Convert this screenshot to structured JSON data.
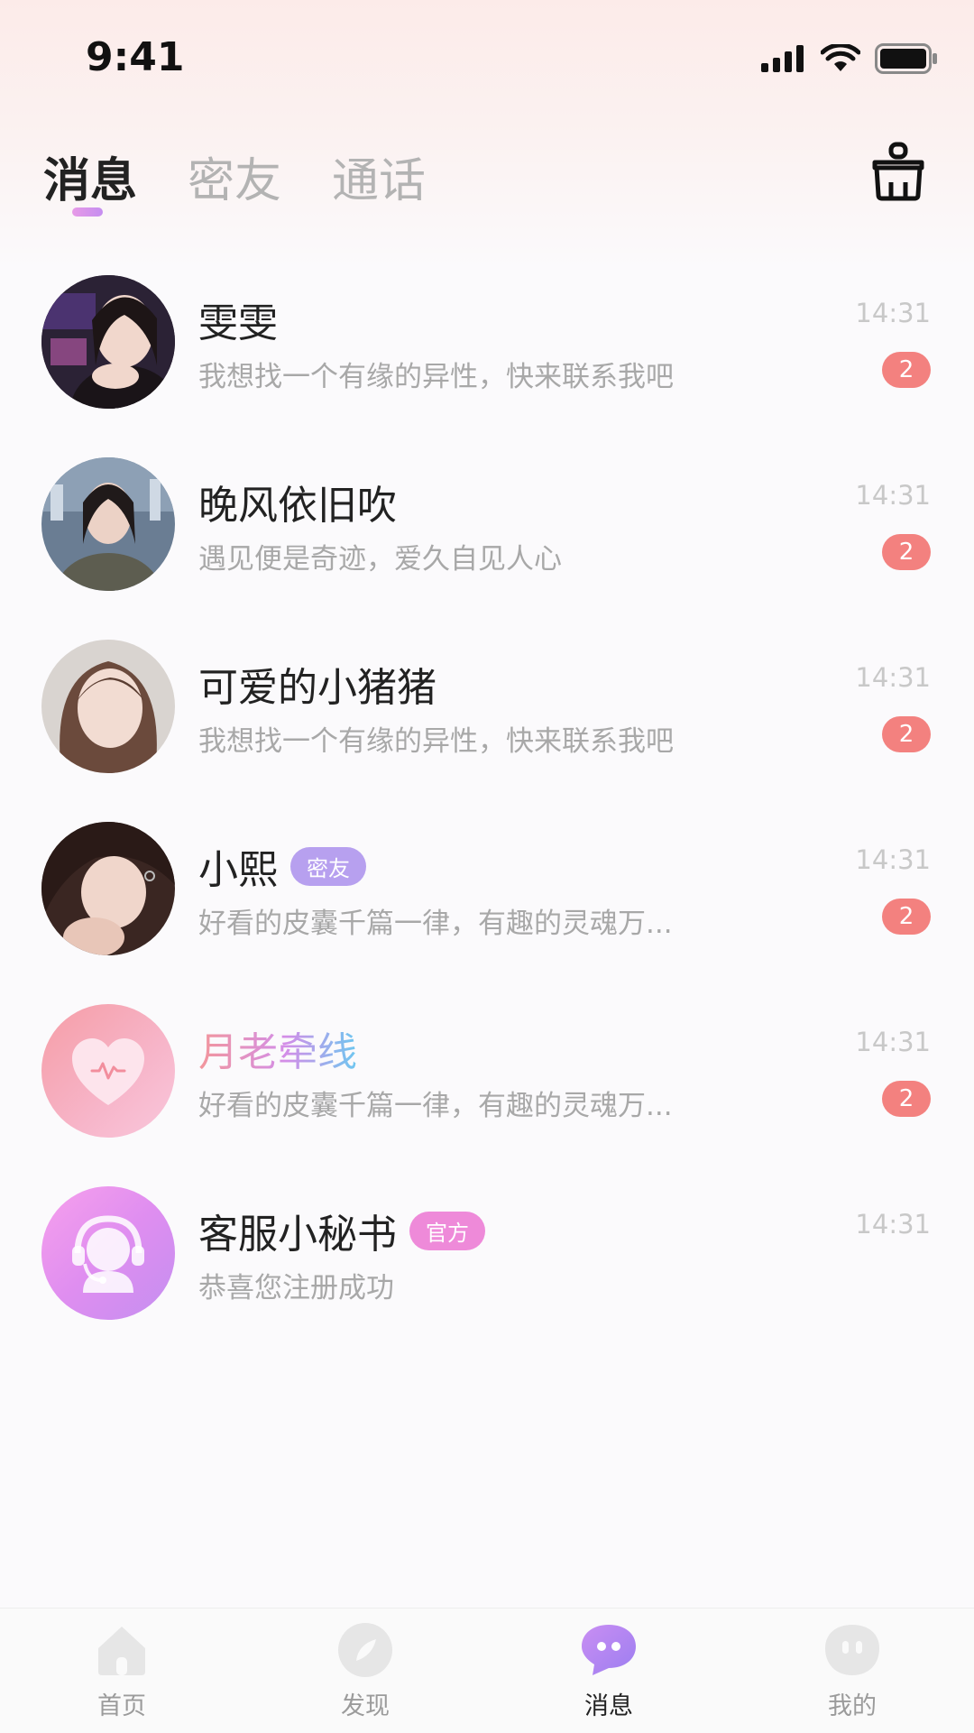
{
  "status_bar": {
    "time": "9:41"
  },
  "header": {
    "tabs": [
      {
        "label": "消息",
        "active": true
      },
      {
        "label": "密友",
        "active": false
      },
      {
        "label": "通话",
        "active": false
      }
    ],
    "clear_icon": "broom-icon"
  },
  "conversations": [
    {
      "name": "雯雯",
      "preview": "我想找一个有缘的异性，快来联系我吧",
      "time": "14:31",
      "unread": "2",
      "tag": ""
    },
    {
      "name": "晚风依旧吹",
      "preview": "遇见便是奇迹，爱久自见人心",
      "time": "14:31",
      "unread": "2",
      "tag": ""
    },
    {
      "name": "可爱的小猪猪",
      "preview": "我想找一个有缘的异性，快来联系我吧",
      "time": "14:31",
      "unread": "2",
      "tag": ""
    },
    {
      "name": "小熙",
      "preview": "好看的皮囊千篇一律，有趣的灵魂万...",
      "time": "14:31",
      "unread": "2",
      "tag": "密友"
    },
    {
      "name": "月老牵线",
      "preview": "好看的皮囊千篇一律，有趣的灵魂万...",
      "time": "14:31",
      "unread": "2",
      "tag": ""
    },
    {
      "name": "客服小秘书",
      "preview": "恭喜您注册成功",
      "time": "14:31",
      "unread": "",
      "tag": "官方"
    }
  ],
  "tabbar": [
    {
      "label": "首页",
      "icon": "home-icon",
      "active": false
    },
    {
      "label": "发现",
      "icon": "compass-icon",
      "active": false
    },
    {
      "label": "消息",
      "icon": "chat-bubble-icon",
      "active": true
    },
    {
      "label": "我的",
      "icon": "profile-icon",
      "active": false
    }
  ],
  "colors": {
    "accent": "#c58ef0",
    "unread_badge": "#f3817f",
    "tag_friend": "#b7a0ef",
    "tag_official": "#ee8ad9"
  }
}
